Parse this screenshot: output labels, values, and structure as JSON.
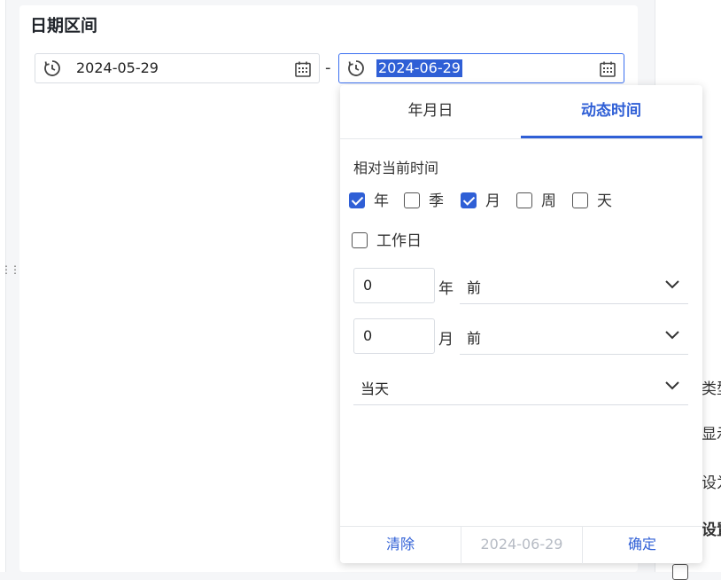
{
  "title": "日期区间",
  "range": {
    "start": "2024-05-29",
    "end": "2024-06-29",
    "separator": "-"
  },
  "popup": {
    "tabs": [
      "年月日",
      "动态时间"
    ],
    "active_tab": 1,
    "section_label": "相对当前时间",
    "units": [
      {
        "label": "年",
        "checked": true
      },
      {
        "label": "季",
        "checked": false
      },
      {
        "label": "月",
        "checked": true
      },
      {
        "label": "周",
        "checked": false
      },
      {
        "label": "天",
        "checked": false
      }
    ],
    "workday": {
      "label": "工作日",
      "checked": false
    },
    "year_offset": {
      "value": "0",
      "unit": "年",
      "direction": "前"
    },
    "month_offset": {
      "value": "0",
      "unit": "月",
      "direction": "前"
    },
    "day_anchor": "当天",
    "footer": {
      "clear": "清除",
      "preview": "2024-06-29",
      "confirm": "确定"
    }
  },
  "right_panel": {
    "labels": [
      "类型",
      "显示",
      "设为",
      "设置"
    ]
  },
  "icons": {
    "clock": "history-clock-icon",
    "calendar": "calendar-icon",
    "chevron": "chevron-down-icon",
    "drag": "drag-handle-icon"
  },
  "colors": {
    "accent": "#2f5fd6",
    "border": "#d9dde3",
    "muted": "#b6bbc4"
  }
}
